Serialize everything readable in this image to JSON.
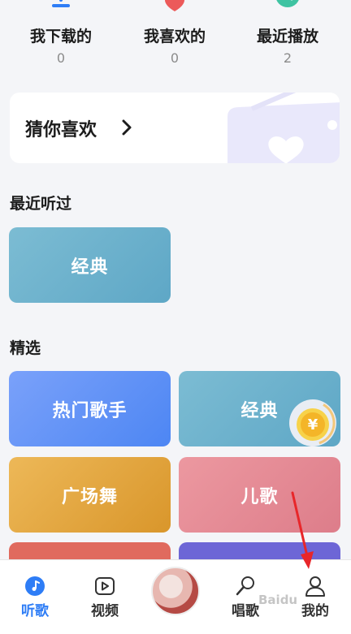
{
  "stats": [
    {
      "label": "我下载的",
      "count": "0",
      "icon": "download-icon"
    },
    {
      "label": "我喜欢的",
      "count": "0",
      "icon": "heart-icon"
    },
    {
      "label": "最近播放",
      "count": "2",
      "icon": "clock-icon"
    }
  ],
  "recommend": {
    "title": "猜你喜欢"
  },
  "recent": {
    "title": "最近听过",
    "items": [
      {
        "label": "经典"
      }
    ]
  },
  "featured": {
    "title": "精选",
    "items": [
      {
        "label": "热门歌手"
      },
      {
        "label": "经典"
      },
      {
        "label": "广场舞"
      },
      {
        "label": "儿歌"
      }
    ]
  },
  "tabs": [
    {
      "label": "听歌",
      "icon": "music-note-icon",
      "active": true
    },
    {
      "label": "视频",
      "icon": "video-play-icon"
    },
    {
      "label": "",
      "icon": "album-disc-icon"
    },
    {
      "label": "唱歌",
      "icon": "microphone-icon"
    },
    {
      "label": "我的",
      "icon": "person-icon"
    }
  ],
  "colors": {
    "accent": "#2e7df6",
    "recent_tile": "#6fb3cf",
    "hot_singers": "#5b8ff5",
    "classic": "#6cb0cc",
    "square_dance": "#e2a640",
    "kids": "#e48b95",
    "annotation_arrow": "#e8262a"
  },
  "coin": {
    "symbol": "¥"
  },
  "watermark": "Baidu"
}
